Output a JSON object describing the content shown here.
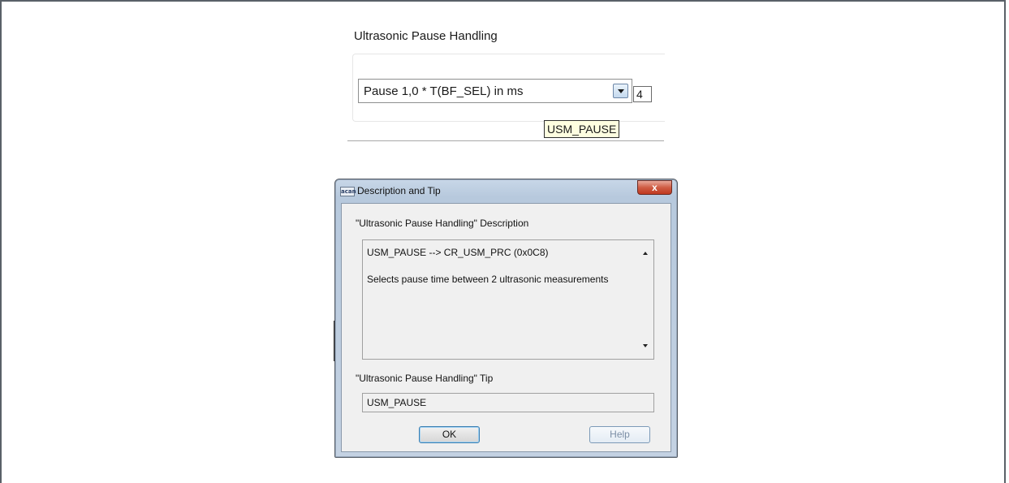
{
  "group": {
    "title": "Ultrasonic Pause Handling",
    "combo_value": "Pause 1,0 * T(BF_SEL) in ms",
    "field_value": "4",
    "tooltip": "USM_PAUSE"
  },
  "dialog": {
    "title": "Description and Tip",
    "app_icon_label": "acan",
    "close_glyph": "x",
    "description_label": "\"Ultrasonic Pause Handling\" Description",
    "description_lines": [
      "USM_PAUSE --> CR_USM_PRC (0x0C8)",
      "Selects pause time between 2 ultrasonic measurements"
    ],
    "tip_label": "\"Ultrasonic Pause Handling\" Tip",
    "tip_value": "USM_PAUSE",
    "ok_label": "OK",
    "help_label": "Help"
  },
  "icons": {
    "combo_arrow": "chevron-down-icon",
    "close": "close-icon",
    "scroll_up": "scroll-up-icon",
    "scroll_down": "scroll-down-icon"
  },
  "colors": {
    "tooltip_bg": "#fefee0",
    "close_button": "#c0391f",
    "dialog_frame": "#b7c9dd"
  }
}
